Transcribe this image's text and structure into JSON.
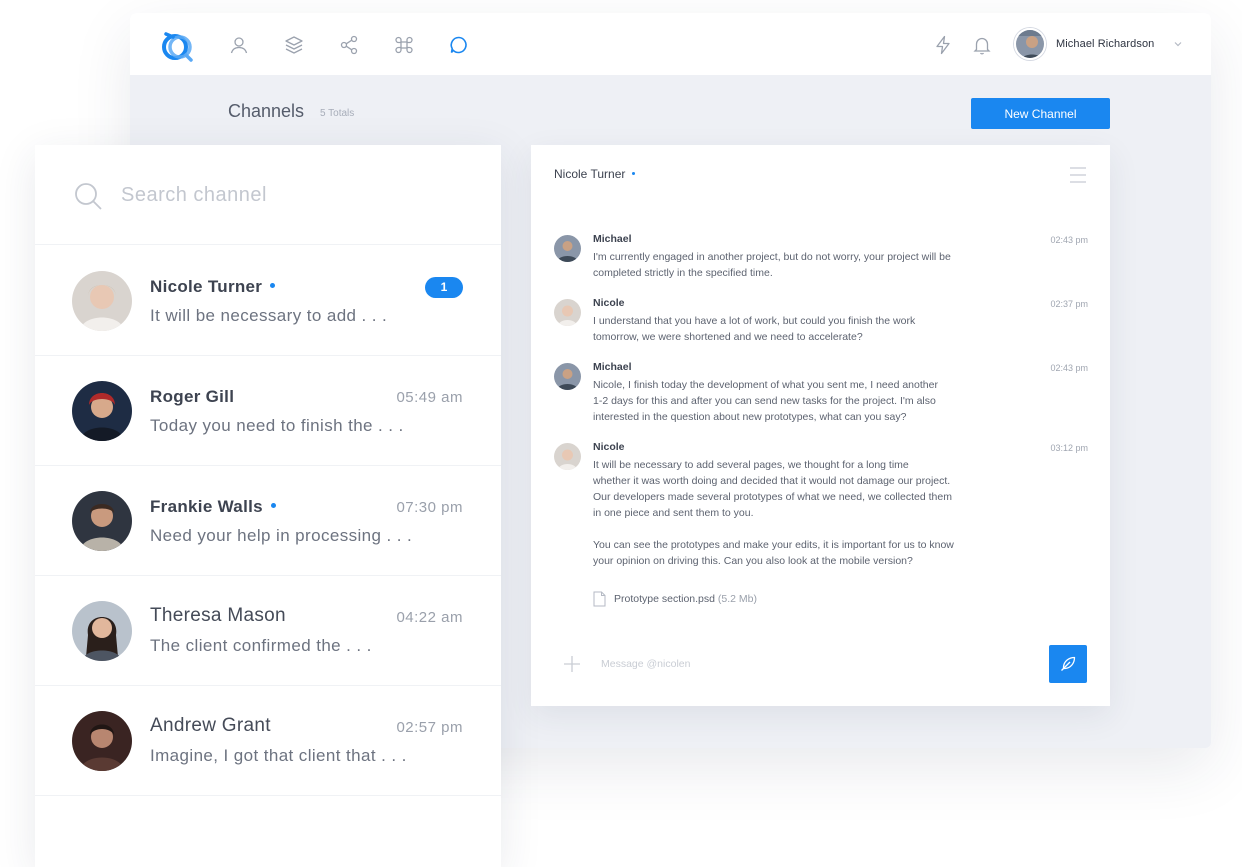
{
  "topbar": {
    "nav_icons": [
      "user-icon",
      "layers-icon",
      "share-icon",
      "command-icon",
      "chat-icon"
    ],
    "right_icons": [
      "lightning-icon",
      "bell-icon"
    ],
    "user_name": "Michael Richardson"
  },
  "header": {
    "title": "Channels",
    "count": "5 Totals",
    "new_channel_label": "New Channel"
  },
  "search": {
    "placeholder": "Search channel"
  },
  "channels": [
    {
      "name": "Nicole Turner",
      "online": true,
      "preview": "It will be necessary to add . . .",
      "time": "",
      "badge": "1"
    },
    {
      "name": "Roger Gill",
      "online": false,
      "preview": "Today you need to finish the . . .",
      "time": "05:49 am",
      "badge": ""
    },
    {
      "name": "Frankie Walls",
      "online": true,
      "preview": "Need your help in processing . . .",
      "time": "07:30 pm",
      "badge": ""
    },
    {
      "name": "Theresa Mason",
      "online": false,
      "preview": "The client confirmed the . . .",
      "time": "04:22 am",
      "badge": ""
    },
    {
      "name": "Andrew Grant",
      "online": false,
      "preview": "Imagine, I got that client that . . .",
      "time": "02:57 pm",
      "badge": ""
    }
  ],
  "chat": {
    "contact_name": "Nicole Turner",
    "messages": [
      {
        "author": "Michael",
        "time": "02:43 pm",
        "text": "I'm currently engaged in another project, but do not worry, your project will be\ncompleted strictly in the specified time."
      },
      {
        "author": "Nicole",
        "time": "02:37 pm",
        "text": "I understand that you have a lot of work, but could you finish the work\ntomorrow, we were shortened and we need to accelerate?"
      },
      {
        "author": "Michael",
        "time": "02:43 pm",
        "text": "Nicole, I finish today the development of what you sent me, I need another\n1-2 days for this and after you can send new tasks for the project. I'm also\ninterested in the question about new prototypes, what can you say?"
      },
      {
        "author": "Nicole",
        "time": "03:12 pm",
        "text": "It will be necessary to add several pages, we thought for a long time\nwhether it was worth doing and decided that it would not damage our project.\nOur developers made several prototypes of what we need, we collected them\nin one piece and sent them to you.\n\nYou can see the prototypes and make your edits, it is important for us to know\nyour opinion on driving this. Can you also look at the mobile version?"
      }
    ],
    "attachment": {
      "file_name": "Prototype section.psd",
      "size": "(5.2 Mb)"
    },
    "compose_placeholder": "Message @nicolen"
  },
  "colors": {
    "accent": "#1a87f0",
    "background": "#eef0f5"
  }
}
